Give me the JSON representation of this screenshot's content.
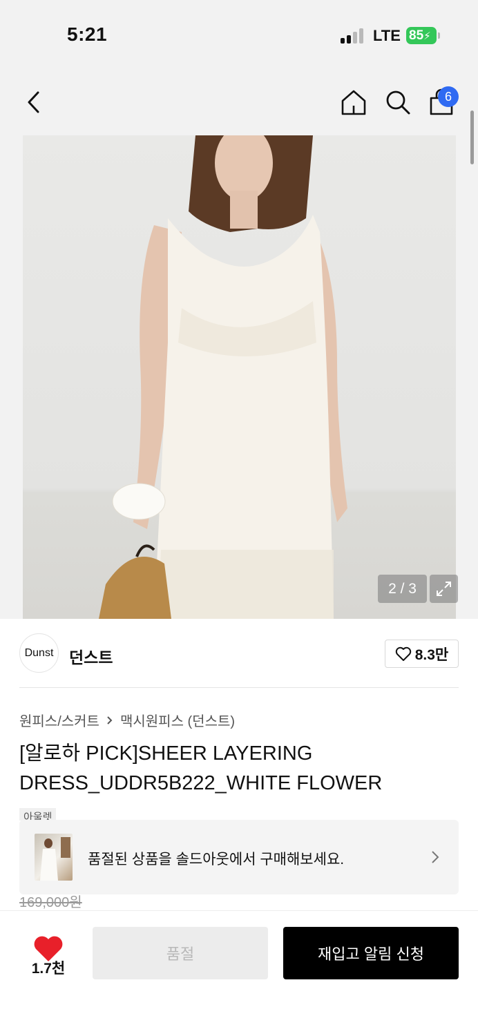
{
  "status_bar": {
    "time": "5:21",
    "network": "LTE",
    "battery": "85"
  },
  "nav": {
    "cart_count": "6"
  },
  "gallery": {
    "counter": "2 / 3"
  },
  "brand": {
    "logo_text": "Dunst",
    "name": "던스트",
    "likes": "8.3만"
  },
  "breadcrumb": {
    "category": "원피스/스커트",
    "subcategory": "맥시원피스 (던스트)"
  },
  "product": {
    "title": "[알로하 PICK]SHEER LAYERING DRESS_UDDR5B222_WHITE FLOWER",
    "tag": "아울렛",
    "original_price": "169,000원"
  },
  "banner": {
    "text": "품절된 상품을 솔드아웃에서 구매해보세요."
  },
  "bottom_bar": {
    "wish_count": "1.7천",
    "soldout_label": "품절",
    "restock_label": "재입고 알림 신청"
  },
  "colors": {
    "accent_blue": "#2f6af2",
    "heart_red": "#e8202a",
    "battery_green": "#34c759"
  }
}
